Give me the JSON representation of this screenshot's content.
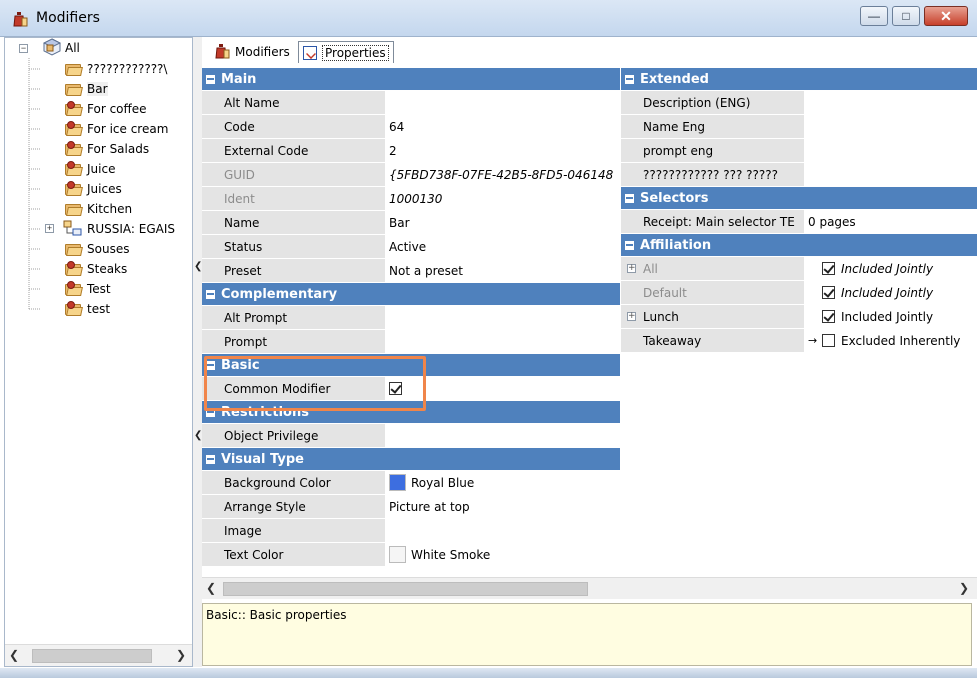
{
  "window": {
    "title": "Modifiers",
    "icon": "modifier-icon",
    "buttons": [
      "minimize",
      "maximize",
      "close"
    ]
  },
  "tree": {
    "root": "All",
    "items": [
      {
        "label": "????????????\\",
        "expandable": false
      },
      {
        "label": "Bar",
        "expandable": false,
        "selected": true
      },
      {
        "label": "For coffee",
        "expandable": false
      },
      {
        "label": "For ice cream",
        "expandable": false
      },
      {
        "label": "For Salads",
        "expandable": false
      },
      {
        "label": "Juice",
        "expandable": false
      },
      {
        "label": "Juices",
        "expandable": false
      },
      {
        "label": "Kitchen",
        "expandable": false
      },
      {
        "label": "RUSSIA: EGAIS",
        "expandable": true
      },
      {
        "label": "Souses",
        "expandable": false
      },
      {
        "label": "Steaks",
        "expandable": false
      },
      {
        "label": "Test",
        "expandable": false
      },
      {
        "label": "test",
        "expandable": false
      }
    ]
  },
  "tabs": [
    {
      "label": "Modifiers",
      "icon": "modifier-icon",
      "active": false
    },
    {
      "label": "Properties",
      "icon": "properties-icon",
      "active": true
    }
  ],
  "left_grid": {
    "main": {
      "title": "Main",
      "rows": [
        {
          "key": "Alt Name",
          "value": ""
        },
        {
          "key": "Code",
          "value": "64"
        },
        {
          "key": "External Code",
          "value": "2"
        },
        {
          "key": "GUID",
          "value": "{5FBD738F-07FE-42B5-8FD5-046148",
          "disabled": true
        },
        {
          "key": "Ident",
          "value": "1000130",
          "disabled": true
        },
        {
          "key": "Name",
          "value": "Bar"
        },
        {
          "key": "Status",
          "value": "Active"
        },
        {
          "key": "Preset",
          "value": "Not a preset"
        }
      ]
    },
    "complementary": {
      "title": "Complementary",
      "rows": [
        {
          "key": "Alt Prompt",
          "value": ""
        },
        {
          "key": "Prompt",
          "value": ""
        }
      ]
    },
    "basic": {
      "title": "Basic",
      "rows": [
        {
          "key": "Common Modifier",
          "checked": true
        }
      ]
    },
    "restrictions": {
      "title": "Restrictions",
      "rows": [
        {
          "key": "Object Privilege",
          "value": ""
        }
      ]
    },
    "visual_type": {
      "title": "Visual Type",
      "rows": [
        {
          "key": "Background Color",
          "value": "Royal Blue",
          "color": "#3d6ee0"
        },
        {
          "key": "Arrange Style",
          "value": "Picture at top"
        },
        {
          "key": "Image",
          "value": ""
        },
        {
          "key": "Text Color",
          "value": "White Smoke",
          "color": "#f5f5f5"
        }
      ]
    }
  },
  "right_grid": {
    "extended": {
      "title": "Extended",
      "rows": [
        {
          "key": "Description (ENG)",
          "value": ""
        },
        {
          "key": "Name Eng",
          "value": ""
        },
        {
          "key": "prompt eng",
          "value": ""
        },
        {
          "key": "???????????? ??? ?????",
          "value": ""
        }
      ]
    },
    "selectors": {
      "title": "Selectors",
      "rows": [
        {
          "key": "Receipt: Main selector TE",
          "value": "0 pages"
        }
      ]
    },
    "affiliation": {
      "title": "Affiliation",
      "rows": [
        {
          "key": "All",
          "value": "Included Jointly",
          "checked": true,
          "expandable": true,
          "disabled": true
        },
        {
          "key": "Default",
          "value": "Included Jointly",
          "checked": true,
          "expandable": false,
          "disabled": true
        },
        {
          "key": "Lunch",
          "value": "Included Jointly",
          "checked": true,
          "expandable": true,
          "disabled": false
        },
        {
          "key": "Takeaway",
          "value": "Excluded Inherently",
          "checked": false,
          "expandable": false,
          "disabled": false
        }
      ]
    }
  },
  "description": "Basic:: Basic properties",
  "colors": {
    "section_header": "#4f81bd",
    "highlight": "#f0854a",
    "description_bg": "#fffde1"
  }
}
